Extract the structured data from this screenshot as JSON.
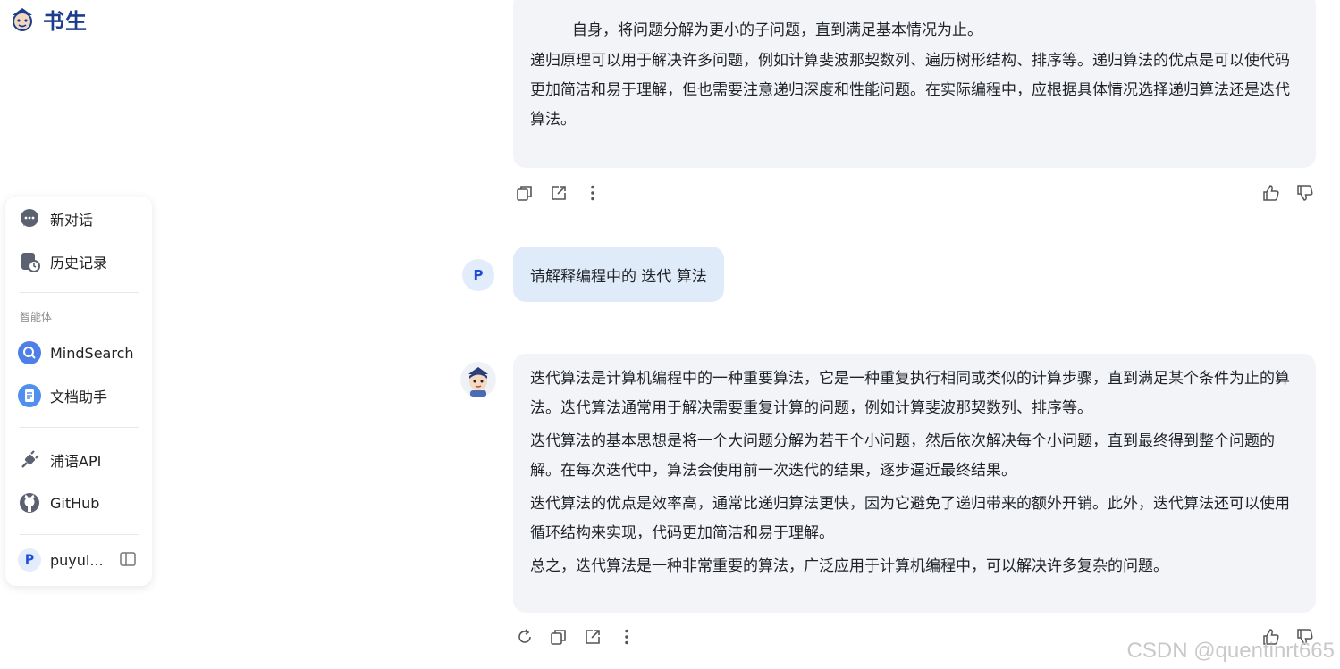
{
  "app": {
    "logo_text": "书生"
  },
  "sidebar": {
    "new_chat": "新对话",
    "history": "历史记录",
    "section_agents": "智能体",
    "agents": [
      "MindSearch",
      "文档助手"
    ],
    "links": [
      "浦语API",
      "GitHub"
    ],
    "user_initial": "P",
    "user_name": "puyul..."
  },
  "chat": {
    "prev_answer": {
      "cut_line": "自身，将问题分解为更小的子问题，直到满足基本情况为止。",
      "paragraphs": [
        "递归原理可以用于解决许多问题，例如计算斐波那契数列、遍历树形结构、排序等。递归算法的优点是可以使代码更加简洁和易于理解，但也需要注意递归深度和性能问题。在实际编程中，应根据具体情况选择递归算法还是迭代算法。"
      ]
    },
    "user_initial": "P",
    "user_message": "请解释编程中的 迭代 算法",
    "answer": {
      "paragraphs": [
        "迭代算法是计算机编程中的一种重要算法，它是一种重复执行相同或类似的计算步骤，直到满足某个条件为止的算法。迭代算法通常用于解决需要重复计算的问题，例如计算斐波那契数列、排序等。",
        "迭代算法的基本思想是将一个大问题分解为若干个小问题，然后依次解决每个小问题，直到最终得到整个问题的解。在每次迭代中，算法会使用前一次迭代的结果，逐步逼近最终结果。",
        "迭代算法的优点是效率高，通常比递归算法更快，因为它避免了递归带来的额外开销。此外，迭代算法还可以使用循环结构来实现，代码更加简洁和易于理解。",
        "总之，迭代算法是一种非常重要的算法，广泛应用于计算机编程中，可以解决许多复杂的问题。"
      ]
    }
  },
  "watermark": "CSDN @quentinrt665",
  "colors": {
    "accent": "#1c3d8f",
    "user_bubble": "#e0ebf9",
    "ai_bubble": "#f3f4f7"
  }
}
